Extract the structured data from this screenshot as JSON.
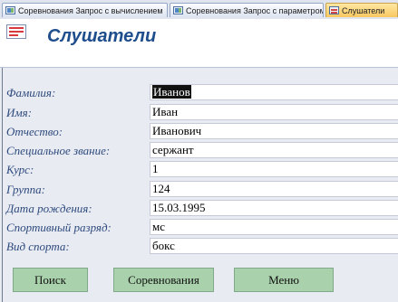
{
  "tabs": [
    {
      "label": "Соревнования Запрос с вычислением",
      "active": false
    },
    {
      "label": "Соревнования Запрос с параметром",
      "active": false
    },
    {
      "label": "Слушатели",
      "active": true
    }
  ],
  "form": {
    "title": "Слушатели",
    "icon": "form-icon"
  },
  "fields": [
    {
      "label": "Фамилия:",
      "value": "Иванов"
    },
    {
      "label": "Имя:",
      "value": "Иван"
    },
    {
      "label": "Отчество:",
      "value": "Иванович"
    },
    {
      "label": "Специальное звание:",
      "value": "сержант"
    },
    {
      "label": "Курс:",
      "value": "1"
    },
    {
      "label": "Группа:",
      "value": "124"
    },
    {
      "label": "Дата рождения:",
      "value": "15.03.1995"
    },
    {
      "label": "Спортивный разряд:",
      "value": "мс"
    },
    {
      "label": "Вид спорта:",
      "value": "бокс"
    }
  ],
  "buttons": {
    "search": "Поиск",
    "competitions": "Соревнования",
    "menu": "Меню"
  },
  "colors": {
    "title": "#1f4e8c",
    "label": "#2d4a7c",
    "button": "#a9d1ab",
    "active_tab": "#f8c860"
  }
}
